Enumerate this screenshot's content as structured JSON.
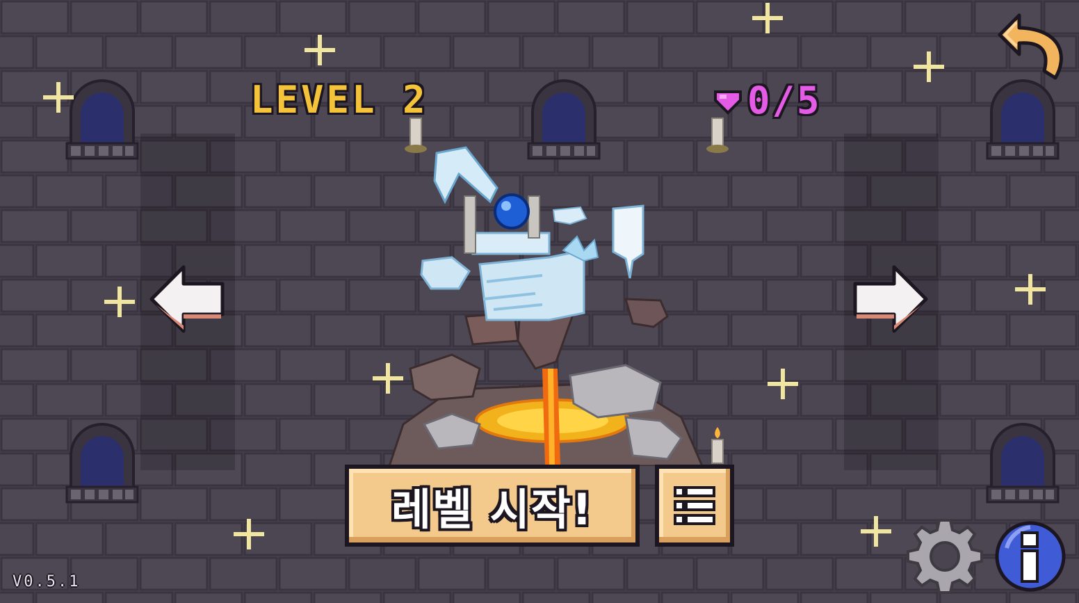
{
  "level": {
    "title": "LEVEL 2"
  },
  "gems": {
    "count": "0/5"
  },
  "buttons": {
    "start_label": "레벨 시작!",
    "prev_icon": "left-arrow-icon",
    "next_icon": "right-arrow-icon",
    "back_icon": "undo-arrow-icon",
    "list_icon": "list-icon",
    "settings_icon": "gear-icon",
    "info_icon": "info-icon"
  },
  "version": "V0.5.1",
  "colors": {
    "background": "#4a4450",
    "level_title": "#f5c33a",
    "gem_counter": "#e45be6",
    "button_fill": "#f3c98c",
    "arrow_undo": "#f3b45e",
    "info_blue": "#3f5bd6"
  }
}
